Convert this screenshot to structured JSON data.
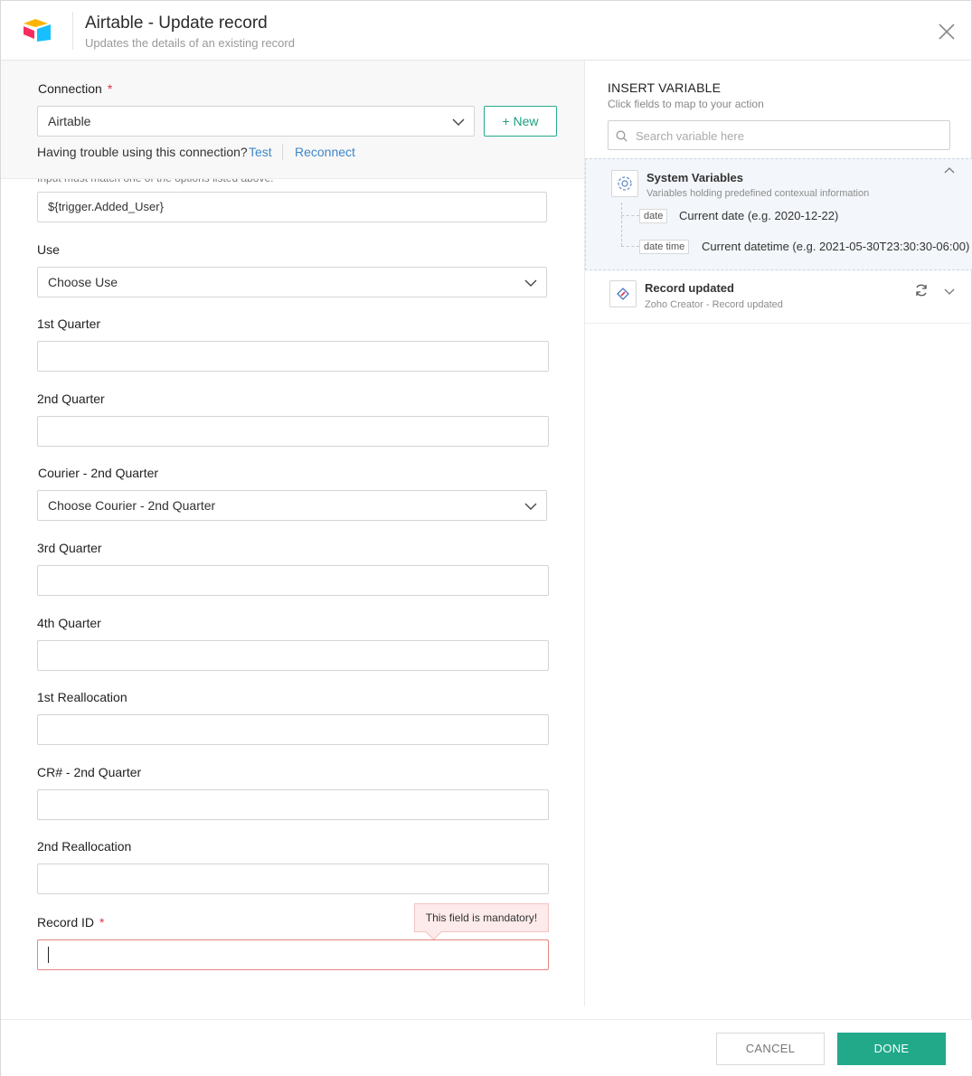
{
  "header": {
    "title": "Airtable - Update record",
    "subtitle": "Updates the details of an existing record"
  },
  "connection": {
    "label": "Connection",
    "required_mark": "*",
    "selected": "Airtable",
    "new_button": "+ New",
    "trouble_text": "Having trouble using this connection?",
    "test_link": "Test",
    "reconnect_link": "Reconnect"
  },
  "form": {
    "cut_note": "Input must match one of the options listed above.",
    "added_user_value": "${trigger.Added_User}",
    "fields": {
      "use": {
        "label": "Use",
        "placeholder": "Choose Use"
      },
      "q1": {
        "label": "1st Quarter"
      },
      "q2": {
        "label": "2nd Quarter"
      },
      "courier_q2": {
        "label": "Courier - 2nd Quarter",
        "placeholder": "Choose Courier - 2nd Quarter"
      },
      "q3": {
        "label": "3rd Quarter"
      },
      "q4": {
        "label": "4th Quarter"
      },
      "realloc1": {
        "label": "1st Reallocation"
      },
      "cr_q2": {
        "label": "CR# - 2nd Quarter"
      },
      "realloc2": {
        "label": "2nd Reallocation"
      },
      "record_id": {
        "label": "Record ID",
        "required_mark": "*",
        "error": "This field is mandatory!"
      }
    }
  },
  "insert_variable": {
    "title": "INSERT VARIABLE",
    "subtitle": "Click fields to map to your action",
    "search_placeholder": "Search variable here",
    "system_variables": {
      "title": "System Variables",
      "subtitle": "Variables holding predefined contexual information",
      "items": [
        {
          "tag": "date",
          "label": "Current date (e.g. 2020-12-22)"
        },
        {
          "tag": "date time",
          "label": "Current datetime (e.g. 2021-05-30T23:30:30-06:00)"
        }
      ]
    },
    "record_updated": {
      "title": "Record updated",
      "subtitle": "Zoho Creator - Record updated"
    }
  },
  "footer": {
    "cancel": "CANCEL",
    "done": "DONE"
  },
  "colors": {
    "accent": "#21a98a",
    "link": "#3e86c9",
    "required": "#e0324a",
    "error_border": "#e5867f"
  }
}
